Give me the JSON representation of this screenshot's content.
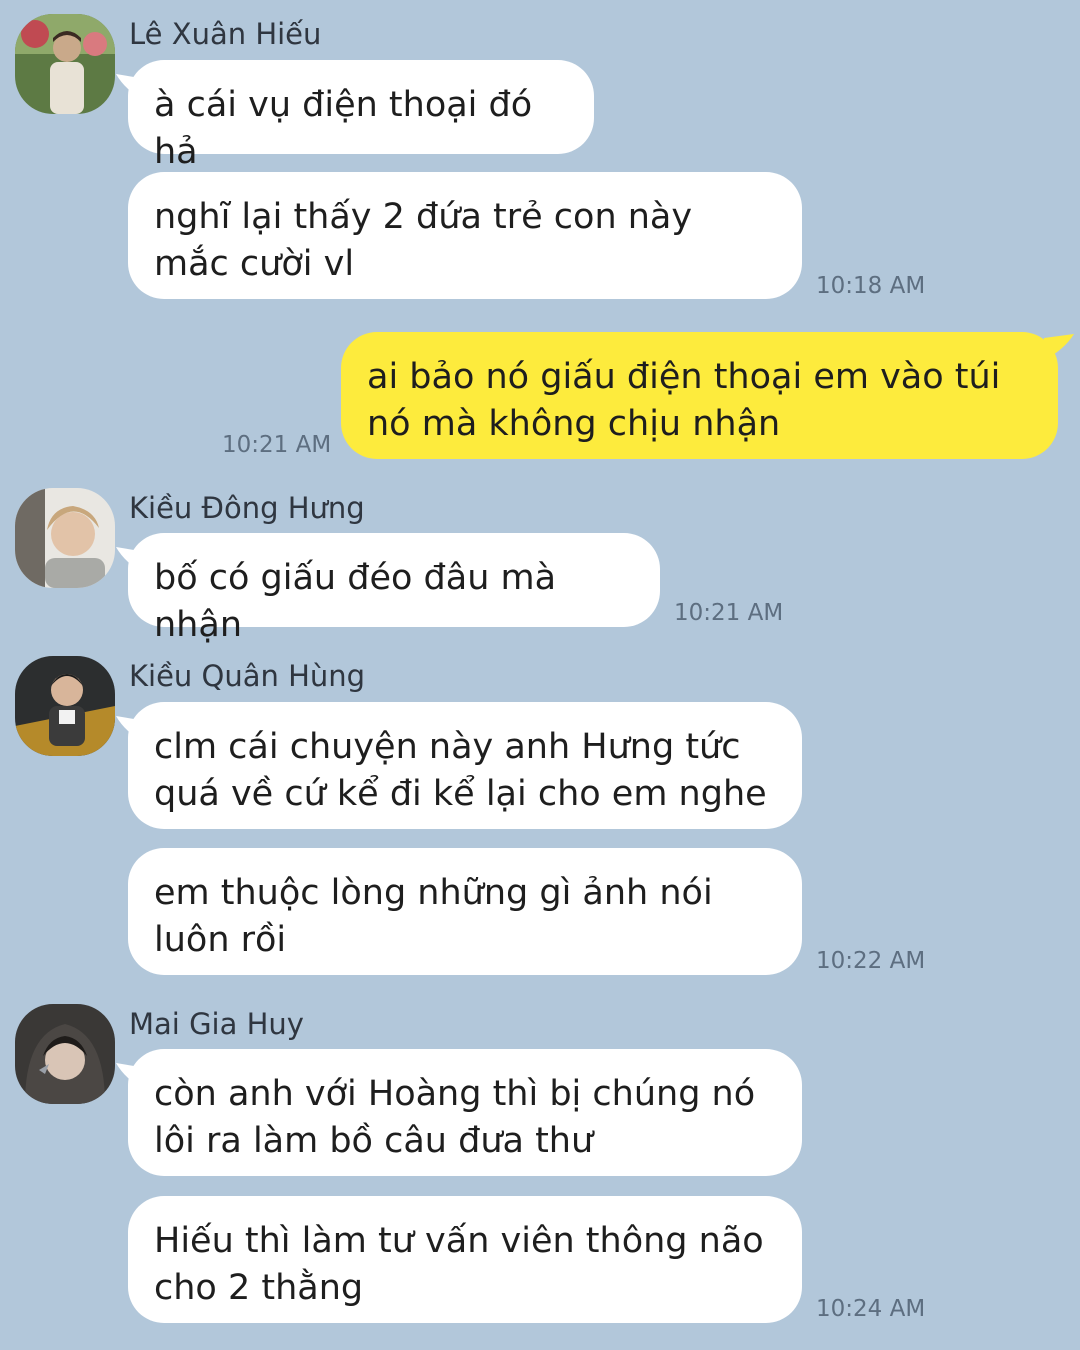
{
  "messages": [
    {
      "sender": "Lê Xuân Hiếu",
      "avatar": "avatar-le-xuan-hieu",
      "bubbles": [
        "à cái vụ điện thoại đó hả",
        "nghĩ lại thấy 2 đứa trẻ con này mắc cười vl"
      ],
      "time": "10:18 AM"
    },
    {
      "sender": "me",
      "bubbles": [
        "ai bảo nó giấu điện thoại em vào túi nó mà không chịu nhận"
      ],
      "time": "10:21 AM"
    },
    {
      "sender": "Kiều Đông Hưng",
      "avatar": "avatar-kieu-dong-hung",
      "bubbles": [
        "bố có giấu đéo đâu mà nhận"
      ],
      "time": "10:21 AM"
    },
    {
      "sender": "Kiều Quân Hùng",
      "avatar": "avatar-kieu-quan-hung",
      "bubbles": [
        "clm cái chuyện này anh Hưng tức quá về cứ kể đi kể lại cho em nghe",
        "em thuộc lòng những gì ảnh nói luôn rồi"
      ],
      "time": "10:22 AM"
    },
    {
      "sender": "Mai Gia Huy",
      "avatar": "avatar-mai-gia-huy",
      "bubbles": [
        "còn anh với Hoàng thì bị chúng nó lôi ra làm bồ câu đưa thư",
        "Hiếu thì làm tư vấn viên thông não cho 2 thằng"
      ],
      "time": "10:24 AM"
    }
  ],
  "colors": {
    "background": "#b2c7da",
    "incoming_bubble": "#ffffff",
    "outgoing_bubble": "#fdeb3d"
  }
}
